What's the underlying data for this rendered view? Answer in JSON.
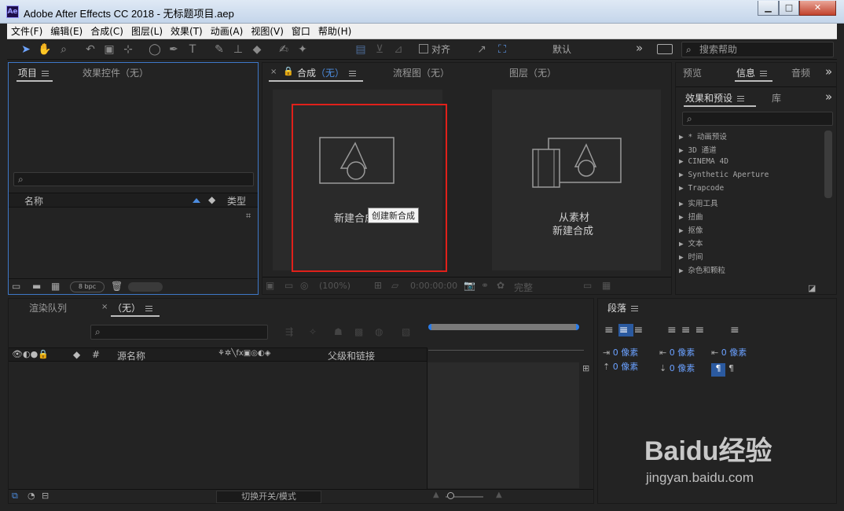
{
  "window": {
    "title": "Adobe After Effects CC 2018 - 无标题项目.aep",
    "logo": "Ae",
    "min": "▁",
    "max": "□",
    "close": "✕"
  },
  "menu": [
    "文件(F)",
    "编辑(E)",
    "合成(C)",
    "图层(L)",
    "效果(T)",
    "动画(A)",
    "视图(V)",
    "窗口",
    "帮助(H)"
  ],
  "toolbar": {
    "align_label": "对齐",
    "workspace": "默认",
    "more": "»",
    "search_placeholder": "搜索帮助"
  },
  "project_panel": {
    "tab": "项目",
    "effects_tab": "效果控件（无）",
    "col_name": "名称",
    "col_type": "类型",
    "bpc": "8 bpc"
  },
  "comp_panel": {
    "tab_prefix": "合成",
    "tab_value": "（无）",
    "flow_tab": "流程图（无）",
    "layer_tab": "图层（无）",
    "new_comp": "新建合成",
    "tooltip": "创建新合成",
    "from_footage_line1": "从素材",
    "from_footage_line2": "新建合成",
    "zoom": "(100%)",
    "timecode": "0:00:00:00",
    "quality": "完整"
  },
  "right_panel": {
    "tabs": [
      "预览",
      "信息",
      "音频"
    ],
    "effects_tab": "效果和预设",
    "lib_tab": "库",
    "more": "»",
    "effects": [
      "* 动画预设",
      "3D 通道",
      "CINEMA 4D",
      "Synthetic Aperture",
      "Trapcode",
      "实用工具",
      "扭曲",
      "抠像",
      "文本",
      "时间",
      "杂色和颗粒"
    ]
  },
  "timeline": {
    "render_tab": "渲染队列",
    "comp_tab": "（无）",
    "col_num": "#",
    "col_source": "源名称",
    "col_parent": "父级和链接",
    "toggle_label": "切换开关/模式"
  },
  "paragraph": {
    "tab": "段落",
    "values": [
      "0 像素",
      "0 像素",
      "0 像素",
      "0 像素",
      "0 像素"
    ]
  },
  "watermark": {
    "brand": "Baidu经验",
    "url": "jingyan.baidu.com"
  }
}
